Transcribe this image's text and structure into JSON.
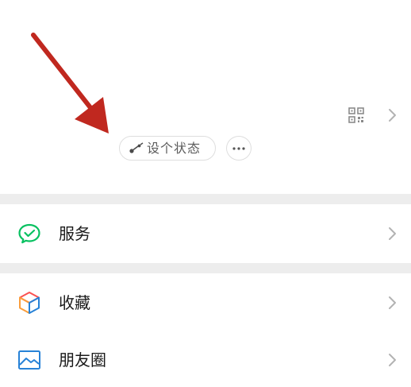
{
  "header": {
    "status_button_label": "设个状态",
    "icons": {
      "qr": "qr-code-icon",
      "chevron": "chevron-right-icon",
      "status": "status-sparkle-icon",
      "more": "more-dots-icon"
    }
  },
  "list": {
    "items": [
      {
        "label": "服务",
        "icon": "wechat-pay-icon",
        "accent": "#07c160"
      },
      {
        "label": "收藏",
        "icon": "favorites-cube-icon",
        "accent": "#fa9d3b"
      },
      {
        "label": "朋友圈",
        "icon": "moments-photo-icon",
        "accent": "#2782d7"
      }
    ]
  },
  "colors": {
    "background": "#ffffff",
    "separator": "#ededed",
    "annotation_arrow": "#c0281f"
  }
}
